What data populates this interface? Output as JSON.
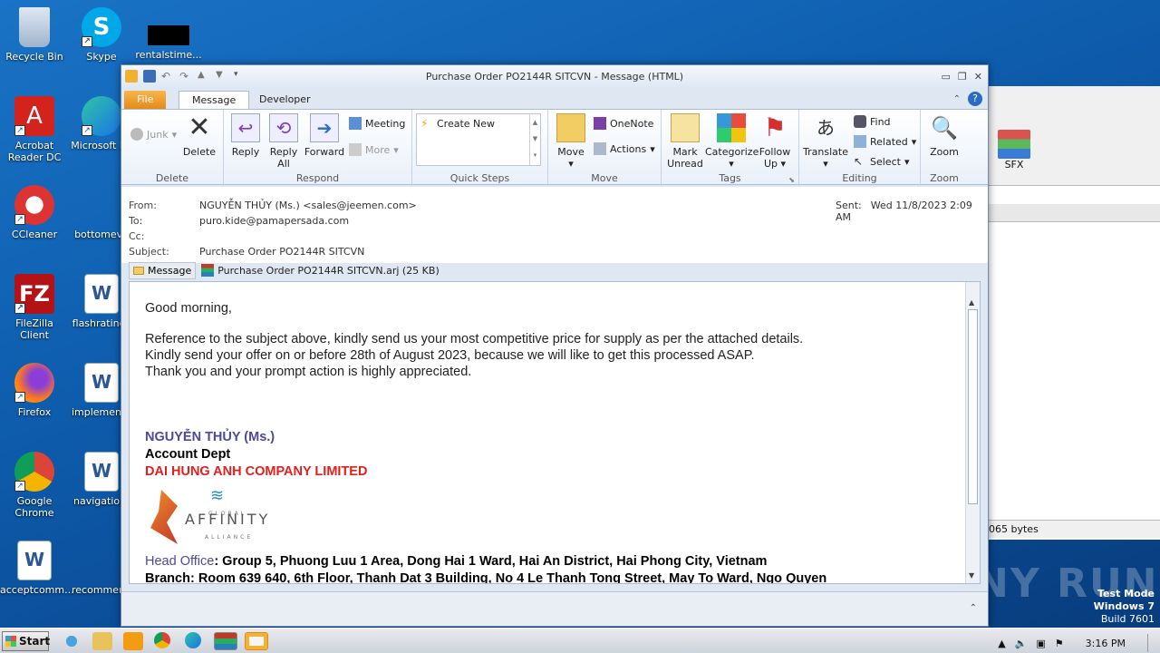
{
  "desktop": {
    "icons": [
      {
        "label": "Recycle Bin"
      },
      {
        "label": "Skype"
      },
      {
        "label": "rentalstime..."
      },
      {
        "label": "Acrobat Reader DC"
      },
      {
        "label": "Microsoft Ed"
      },
      {
        "label": "CCleaner"
      },
      {
        "label": "bottomeve"
      },
      {
        "label": "FileZilla Client"
      },
      {
        "label": "flashratings"
      },
      {
        "label": "Firefox"
      },
      {
        "label": "implementa"
      },
      {
        "label": "Google Chrome"
      },
      {
        "label": "navigationf"
      },
      {
        "label": "acceptcomm..."
      },
      {
        "label": "recommend"
      }
    ],
    "sfx_label": "SFX",
    "bytes_label": "065 bytes",
    "watermark": "ANY RUN",
    "test_mode": [
      "Test Mode",
      "Windows 7",
      "Build 7601"
    ]
  },
  "window": {
    "title": "Purchase Order PO2144R SITCVN  -  Message (HTML)",
    "tabs": {
      "file": "File",
      "message": "Message",
      "developer": "Developer"
    }
  },
  "ribbon": {
    "delete_group": {
      "junk": "Junk",
      "delete": "Delete",
      "title": "Delete"
    },
    "respond_group": {
      "reply": "Reply",
      "reply_all_1": "Reply",
      "reply_all_2": "All",
      "forward": "Forward",
      "meeting": "Meeting",
      "more": "More",
      "title": "Respond"
    },
    "quick_steps": {
      "create_new": "Create New",
      "title": "Quick Steps"
    },
    "move_group": {
      "move": "Move",
      "onenote": "OneNote",
      "actions": "Actions",
      "title": "Move"
    },
    "tags_group": {
      "mark_unread_1": "Mark",
      "mark_unread_2": "Unread",
      "categorize": "Categorize",
      "follow_up_1": "Follow",
      "follow_up_2": "Up",
      "title": "Tags"
    },
    "editing_group": {
      "translate": "Translate",
      "find": "Find",
      "related": "Related",
      "select": "Select",
      "title": "Editing"
    },
    "zoom_group": {
      "zoom": "Zoom",
      "title": "Zoom"
    }
  },
  "header": {
    "from_label": "From:",
    "from_value": "NGUYỄN THỦY (Ms.) <sales@jeemen.com>",
    "to_label": "To:",
    "to_value": "puro.kide@pamapersada.com",
    "cc_label": "Cc:",
    "cc_value": "",
    "subject_label": "Subject:",
    "subject_value": "Purchase Order PO2144R SITCVN",
    "sent_label": "Sent:",
    "sent_value": "Wed 11/8/2023 2:09 AM",
    "message_tab": "Message",
    "attachment": "Purchase Order PO2144R SITCVN.arj (25 KB)"
  },
  "body": {
    "greeting": "Good morning,",
    "line1": "Reference to the subject above, kindly send us your most competitive price for supply as per the attached details.",
    "line2": "Kindly send your offer on or before 28th of August 2023, because we will like to get this processed ASAP.",
    "line3": "Thank you and your prompt action is highly appreciated.",
    "sig_name": "NGUYỄN THỦY (Ms.)",
    "sig_dept": "Account Dept",
    "sig_company": "DAI HUNG ANH COMPANY LIMITED",
    "logo_top": "GLOBAL",
    "logo_main": "AFFINITY",
    "logo_bottom": "ALLIANCE",
    "head_office_label": "Head Office",
    "head_office_value": ": Group 5, Phuong Luu 1 Area, Dong Hai 1 Ward, Hai An District, Hai Phong City, Vietnam",
    "branch_line": "Branch: Room 639 640, 6th Floor,  Thanh Dat 3 Building, No 4 Le Thanh Tong Street, May To Ward, Ngo Quyen"
  },
  "taskbar": {
    "start": "Start",
    "clock": "3:16 PM"
  },
  "colors": {
    "sig_name": "#4a4a9c",
    "sig_company": "#e0201e",
    "head_office": "#4a4a9c"
  }
}
